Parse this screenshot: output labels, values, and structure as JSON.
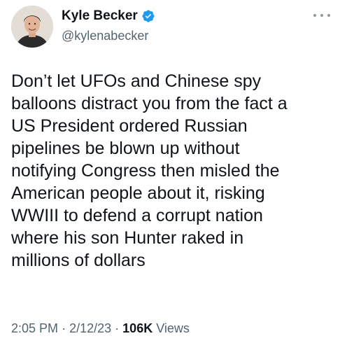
{
  "author": {
    "display_name": "Kyle Becker",
    "handle": "@kylenabecker",
    "verified": true,
    "verified_color": "#1d9bf0"
  },
  "tweet": {
    "lines": [
      "Don’t let UFOs and Chinese spy",
      "balloons distract you from the fact a",
      "US President ordered Russian",
      "pipelines be blown up without",
      "notifying Congress then misled the",
      "American people about it, risking",
      "WWIII to defend a corrupt nation",
      "where his son Hunter raked in",
      "millions of dollars"
    ]
  },
  "meta": {
    "time": "2:05 PM",
    "separator": "·",
    "date": "2/12/23",
    "views_count": "106K",
    "views_label": "Views"
  },
  "icons": {
    "more": "more-horizontal-icon",
    "verified": "verified-badge-icon"
  },
  "colors": {
    "text": "#0f1419",
    "secondary": "#536471",
    "accent": "#1d9bf0"
  }
}
